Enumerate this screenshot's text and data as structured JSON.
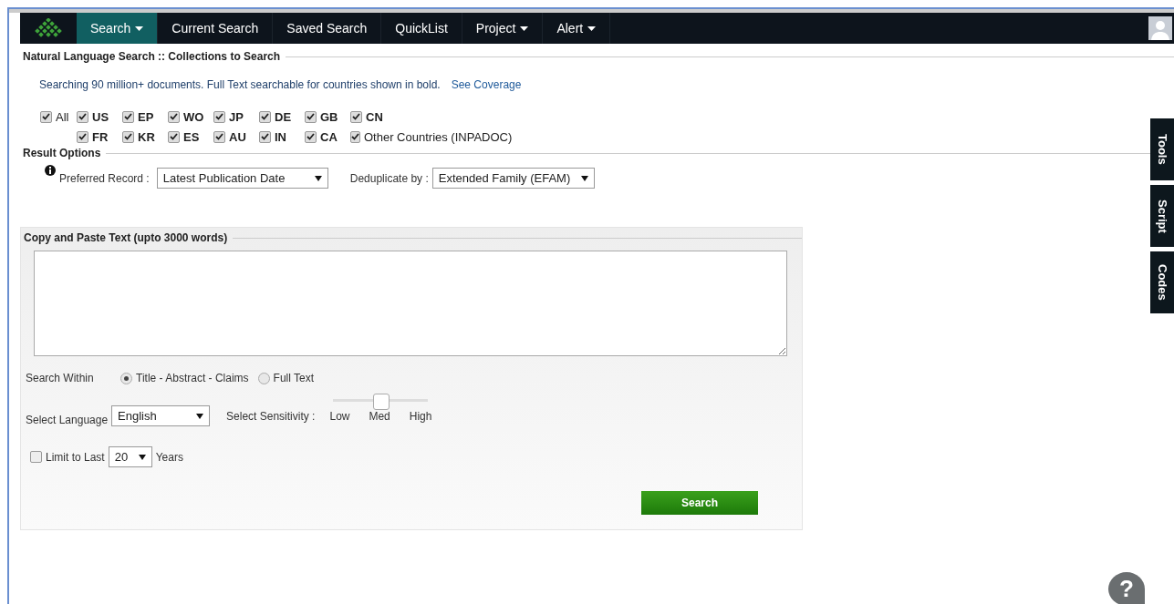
{
  "nav": {
    "items": [
      {
        "label": "Search",
        "dropdown": true,
        "selected": true
      },
      {
        "label": "Current Search",
        "dropdown": false,
        "selected": false
      },
      {
        "label": "Saved Search",
        "dropdown": false,
        "selected": false
      },
      {
        "label": "QuickList",
        "dropdown": false,
        "selected": false
      },
      {
        "label": "Project",
        "dropdown": true,
        "selected": false
      },
      {
        "label": "Alert",
        "dropdown": true,
        "selected": false
      }
    ]
  },
  "collections": {
    "title": "Natural Language Search :: Collections to Search",
    "info": "Searching 90 million+ documents. Full Text searchable for countries shown in bold.",
    "link": "See Coverage",
    "rows": [
      [
        {
          "label": "All",
          "bold": false,
          "checked": true
        },
        {
          "label": "US",
          "bold": true,
          "checked": true
        },
        {
          "label": "EP",
          "bold": true,
          "checked": true
        },
        {
          "label": "WO",
          "bold": true,
          "checked": true
        },
        {
          "label": "JP",
          "bold": true,
          "checked": true
        },
        {
          "label": "DE",
          "bold": true,
          "checked": true
        },
        {
          "label": "GB",
          "bold": true,
          "checked": true
        },
        {
          "label": "CN",
          "bold": true,
          "checked": true
        }
      ],
      [
        {},
        {
          "label": "FR",
          "bold": true,
          "checked": true
        },
        {
          "label": "KR",
          "bold": true,
          "checked": true
        },
        {
          "label": "ES",
          "bold": true,
          "checked": true
        },
        {
          "label": "AU",
          "bold": true,
          "checked": true
        },
        {
          "label": "IN",
          "bold": true,
          "checked": true
        },
        {
          "label": "CA",
          "bold": true,
          "checked": true
        },
        {
          "label": "Other Countries (INPADOC)",
          "bold": false,
          "checked": true
        }
      ]
    ]
  },
  "result_options": {
    "title": "Result Options",
    "preferred_label": "Preferred Record :",
    "preferred_value": "Latest Publication Date",
    "dedup_label": "Deduplicate by :",
    "dedup_value": "Extended Family (EFAM)"
  },
  "text_panel": {
    "title": "Copy and Paste Text (upto 3000 words)",
    "search_within_label": "Search Within",
    "search_within": [
      {
        "label": "Title - Abstract - Claims",
        "selected": true
      },
      {
        "label": "Full Text",
        "selected": false
      }
    ],
    "language_label": "Select Language",
    "language": "English",
    "sensitivity_label": "Select Sensitivity :",
    "sensitivity": {
      "level": 0.5,
      "labels": [
        "Low",
        "Med",
        "High"
      ]
    },
    "limit": {
      "label": "Limit to Last",
      "checked": false,
      "value": "20",
      "suffix": "Years"
    },
    "search_button": "Search"
  },
  "side_tabs": [
    "Tools",
    "Script",
    "Codes"
  ],
  "help": "?"
}
